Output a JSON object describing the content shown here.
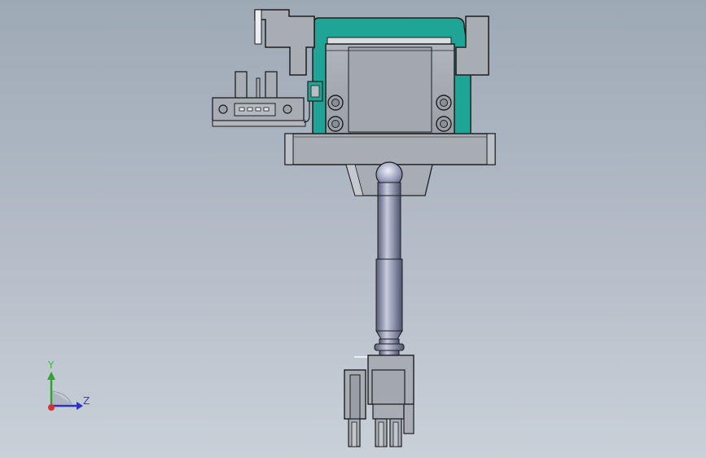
{
  "viewport": {
    "background_top": "#9ea9b6",
    "background_bottom": "#c9d0d8"
  },
  "colors": {
    "part_gray": "#a8adb3",
    "part_gray_dark": "#8c9197",
    "edge": "#1e1e1e",
    "slide_teal": "#1fa596",
    "shaft": "#6e7590",
    "shaft_light": "#c7cbdc"
  },
  "triad": {
    "y_axis_label": "Y",
    "z_axis_label": "Z",
    "x_axis_color": "#d93030",
    "y_axis_color": "#2fa52f",
    "z_axis_color": "#3030c8"
  }
}
